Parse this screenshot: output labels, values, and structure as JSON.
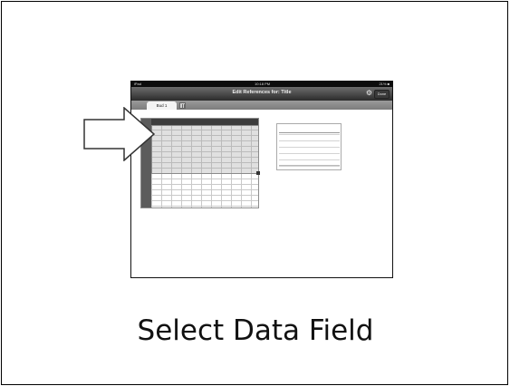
{
  "ipad": {
    "status_bar": {
      "device": "iPad",
      "time": "10:18 PM",
      "battery": "21% ■"
    },
    "nav_bar": {
      "title": "Edit References for: Title",
      "done_label": "Done",
      "settings_icon": "gear-icon"
    },
    "tabs": [
      {
        "label": "Bud 1"
      }
    ],
    "add_sheet_icon": "add-sheet-icon"
  },
  "annotation": {
    "icon": "arrow-right-icon"
  },
  "caption": "Select Data Field"
}
